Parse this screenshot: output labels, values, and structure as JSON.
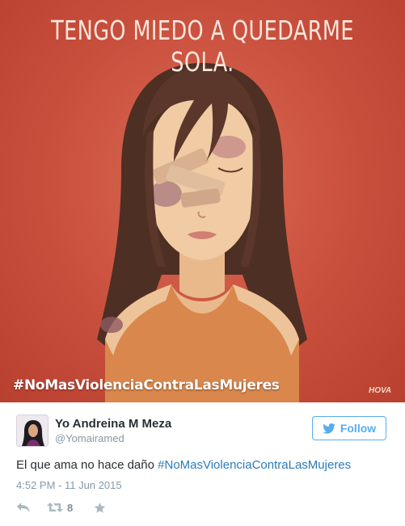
{
  "poster": {
    "title": "TENGO MIEDO A QUEDARME SOLA.",
    "hashtag": "#NoMasViolenciaContraLasMujeres",
    "artist_signature": "HOVA",
    "background_color": "#c94f3d"
  },
  "tweet": {
    "display_name": "Yo Andreina M Meza",
    "handle": "@Yomairamed",
    "follow_label": "Follow",
    "text": "El que ama no hace daño ",
    "hashtag": "#NoMasViolenciaContraLasMujeres",
    "timestamp": "4:52 PM - 11 Jun 2015",
    "retweet_count": "8",
    "accent_color": "#55acee",
    "link_color": "#2b7bb9"
  },
  "icons": {
    "reply": "reply-icon",
    "retweet": "retweet-icon",
    "favorite": "star-icon",
    "follow": "twitter-bird-icon"
  }
}
